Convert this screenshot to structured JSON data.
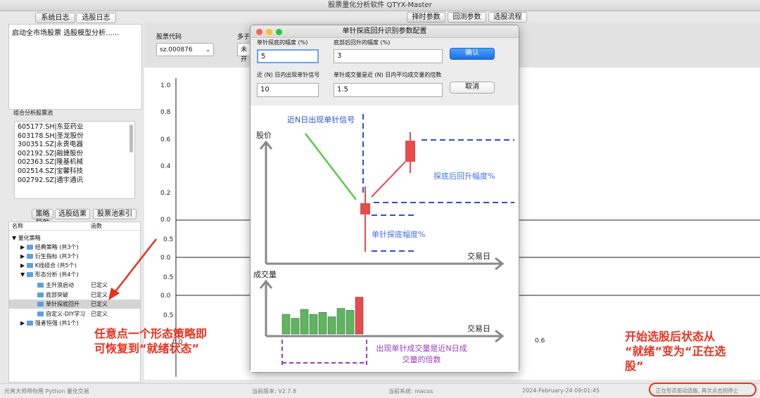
{
  "app": {
    "title": "股票量化分析软件 QTYX-Master"
  },
  "log": {
    "tabs": [
      "系统日志",
      "选股日志"
    ],
    "text": "启动全市场股票 选股模型分析......"
  },
  "top_tabs": [
    "择时参数",
    "回测参数",
    "选股流程"
  ],
  "params": {
    "code_label": "股票代码",
    "code_value": "sz.000876",
    "multi_label": "多子图",
    "multi_value": "未开"
  },
  "pool": {
    "title": "组合分析股票池",
    "items": [
      "605177.SH|东亚药业",
      "603178.SH|圣龙股份",
      "300351.SZ|永贵电器",
      "002192.SZ|融捷股份",
      "002363.SZ|隆基机械",
      "002514.SZ|宝馨科技",
      "002792.SZ|通宇通讯"
    ]
  },
  "nav": {
    "tabs": [
      "策略导航",
      "选股结果",
      "股票池索引"
    ],
    "col_name": "名称",
    "col_func": "函数",
    "root": "量化策略",
    "items": [
      {
        "label": "经典策略 (共3个)",
        "func": ""
      },
      {
        "label": "衍生指标 (共3个)",
        "func": ""
      },
      {
        "label": "K线组合 (共5个)",
        "func": ""
      },
      {
        "label": "形态分析 (共4个)",
        "func": ""
      },
      {
        "label": "主升浪启动",
        "func": "已定义"
      },
      {
        "label": "底部突破",
        "func": "已定义"
      },
      {
        "label": "单针探底回升",
        "func": "已定义"
      },
      {
        "label": "自定义-DIY学习",
        "func": "已定义"
      },
      {
        "label": "强者恒强 (共1个)",
        "func": ""
      }
    ]
  },
  "chart": {
    "yticks1": [
      "1.0",
      "0.8",
      "0.6",
      "0.4",
      "0.2",
      "0.0"
    ],
    "yticks_small": [
      "0.0",
      "0.5",
      "0.0"
    ],
    "xticks": [
      "0.0",
      "0.6"
    ]
  },
  "dialog": {
    "title": "单针探底回升识别参数配置",
    "f1_label": "单针探底的幅度 (%)",
    "f1_value": "5",
    "f2_label": "底部后回升的幅度 (%)",
    "f2_value": "3",
    "f3_label": "近 (N) 日内出现单针信号",
    "f3_value": "10",
    "f4_label": "单针成交量是近 (N) 日内平均成交量的倍数",
    "f4_value": "1.5",
    "ok": "确认",
    "cancel": "取消",
    "diagram": {
      "signal": "近N日出现单针信号",
      "price": "股价",
      "rebound": "探底后回升幅度%",
      "dip": "单针探底幅度%",
      "day1": "交易日",
      "volume": "成交量",
      "day2": "交易日",
      "vol_note": "出现单针成交量是近N日成交量的倍数",
      "volumes": [
        0.4,
        0.32,
        0.5,
        0.4,
        0.44,
        0.35,
        0.52,
        0.48,
        0.75
      ]
    }
  },
  "annotations": {
    "left": "任意点一个形态策略即\n可恢复到“就绪状态”",
    "right": "开始选股后状态从\n“就绪”变为“正在选\n股”"
  },
  "status": {
    "left": "元宵大师带你用 Python 量化交易",
    "version": "当前版本: V2.7.8",
    "system": "当前系统: macos",
    "time": "2024-February-24 09:01:45",
    "state": "正在形态驱动选股, 再次点击则停止"
  },
  "colors": {
    "annot": "#e8321f",
    "blue_dash": "#2a4fd6",
    "green": "#5cb85c",
    "red": "#e84b4b",
    "purple": "#9b3cc0"
  }
}
